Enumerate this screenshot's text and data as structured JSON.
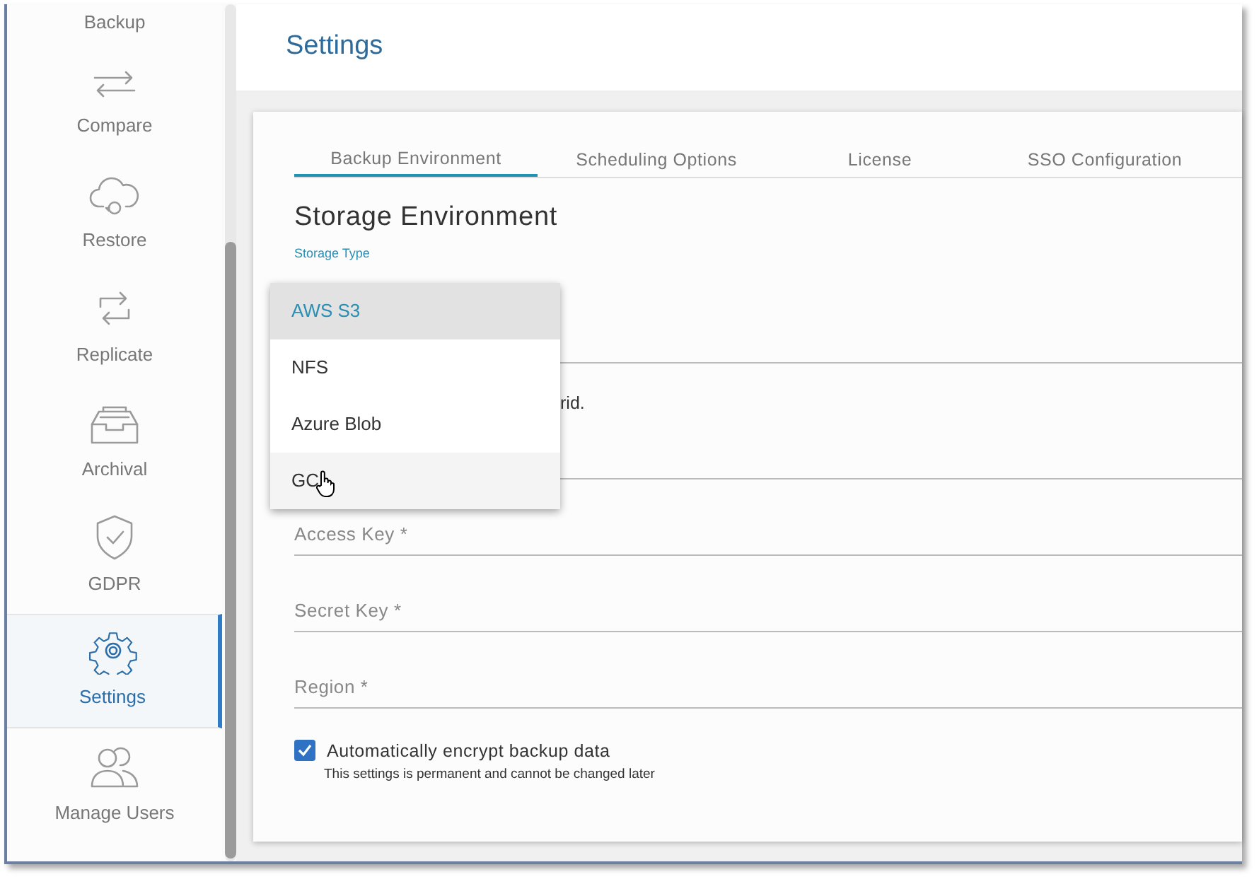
{
  "sidebar": {
    "items": [
      {
        "label": "Backup",
        "kind": "none",
        "selected": false
      },
      {
        "label": "Compare",
        "kind": "arrows",
        "selected": false
      },
      {
        "label": "Restore",
        "kind": "cloud",
        "selected": false
      },
      {
        "label": "Replicate",
        "kind": "cycle",
        "selected": false
      },
      {
        "label": "Archival",
        "kind": "tray",
        "selected": false
      },
      {
        "label": "GDPR",
        "kind": "shield",
        "selected": false
      },
      {
        "label": "Settings",
        "kind": "gear",
        "selected": true
      },
      {
        "label": "Manage Users",
        "kind": "users",
        "selected": false
      }
    ]
  },
  "page_title": "Settings",
  "tabs": [
    {
      "label": "Backup Environment",
      "selected": true
    },
    {
      "label": "Scheduling Options",
      "selected": false
    },
    {
      "label": "License",
      "selected": false
    },
    {
      "label": "SSO Configuration",
      "selected": false
    }
  ],
  "section_title": "Storage Environment",
  "storage_type": {
    "label": "Storage Type",
    "helper_text": "rid.",
    "options": [
      {
        "label": "AWS S3",
        "selected": true,
        "hovered": false
      },
      {
        "label": "NFS",
        "selected": false,
        "hovered": false
      },
      {
        "label": "Azure Blob",
        "selected": false,
        "hovered": false
      },
      {
        "label": "GC",
        "selected": false,
        "hovered": true
      }
    ]
  },
  "fields": [
    {
      "placeholder": "Access Key *"
    },
    {
      "placeholder": "Secret Key *"
    },
    {
      "placeholder": "Region *"
    }
  ],
  "encrypt": {
    "label": "Automatically encrypt backup data",
    "note": "This settings is permanent and cannot be changed later",
    "checked": true
  }
}
